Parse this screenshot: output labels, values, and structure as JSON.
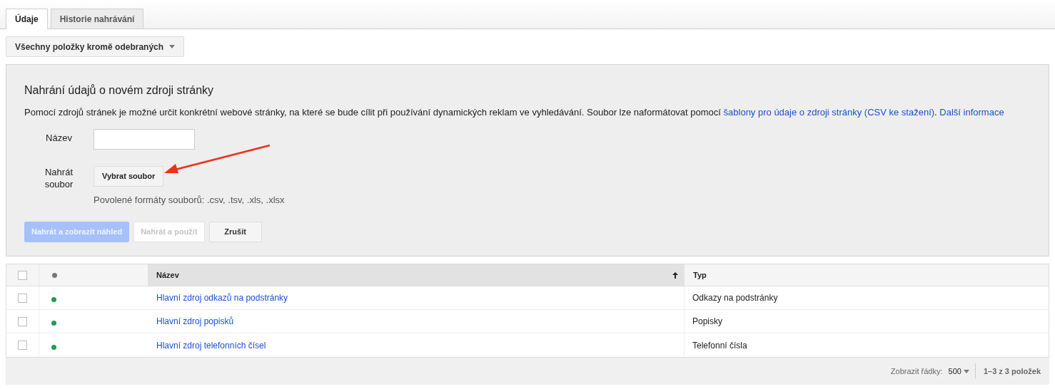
{
  "tabs": [
    {
      "label": "Údaje",
      "selected": true
    },
    {
      "label": "Historie nahrávání",
      "selected": false
    }
  ],
  "filter": {
    "label": "Všechny položky kromě odebraných"
  },
  "upload_panel": {
    "title": "Nahrání údajů o novém zdroji stránky",
    "description": [
      {
        "kind": "text",
        "text": "Pomocí zdrojů stránek je možné určit konkrétní webové stránky, na které se bude cílit při používání dynamických reklam ve vyhledávání. Soubor lze naformátovat pomocí "
      },
      {
        "kind": "link",
        "text": "šablony pro údaje o zdroji stránky (CSV ke stažení)"
      },
      {
        "kind": "text",
        "text": ". "
      },
      {
        "kind": "link",
        "text": "Další informace"
      }
    ],
    "name_label": "Název",
    "file_label": "Nahrát soubor",
    "file_button": "Vybrat soubor",
    "formats_hint": "Povolené formáty souborů: .csv, .tsv, .xls, .xlsx",
    "buttons": [
      {
        "label": "Nahrát a zobrazit náhled",
        "kind": "primary",
        "disabled": true
      },
      {
        "label": "Nahrát a použít",
        "kind": "secondary",
        "disabled": true
      },
      {
        "label": "Zrušit",
        "kind": "secondary",
        "disabled": false
      }
    ]
  },
  "table": {
    "select_all_checked": false,
    "columns": [
      {
        "label": "Název",
        "sorted_ascending": true
      },
      {
        "label": "Typ",
        "sorted_ascending": false
      }
    ],
    "rows": [
      {
        "checked": false,
        "color": "#1e9e4f",
        "name": "Hlavní zdroj odkazů na podstránky",
        "type": "Odkazy na podstránky"
      },
      {
        "checked": false,
        "color": "#1e9e4f",
        "name": "Hlavní zdroj popisků",
        "type": "Popisky"
      },
      {
        "checked": false,
        "color": "#1e9e4f",
        "name": "Hlavní zdroj telefonních čísel",
        "type": "Telefonní čísla"
      }
    ]
  },
  "footer": {
    "rows_label": "Zobrazit řádky:",
    "rows_value": "500",
    "range": "1–3 z 3 položek"
  }
}
